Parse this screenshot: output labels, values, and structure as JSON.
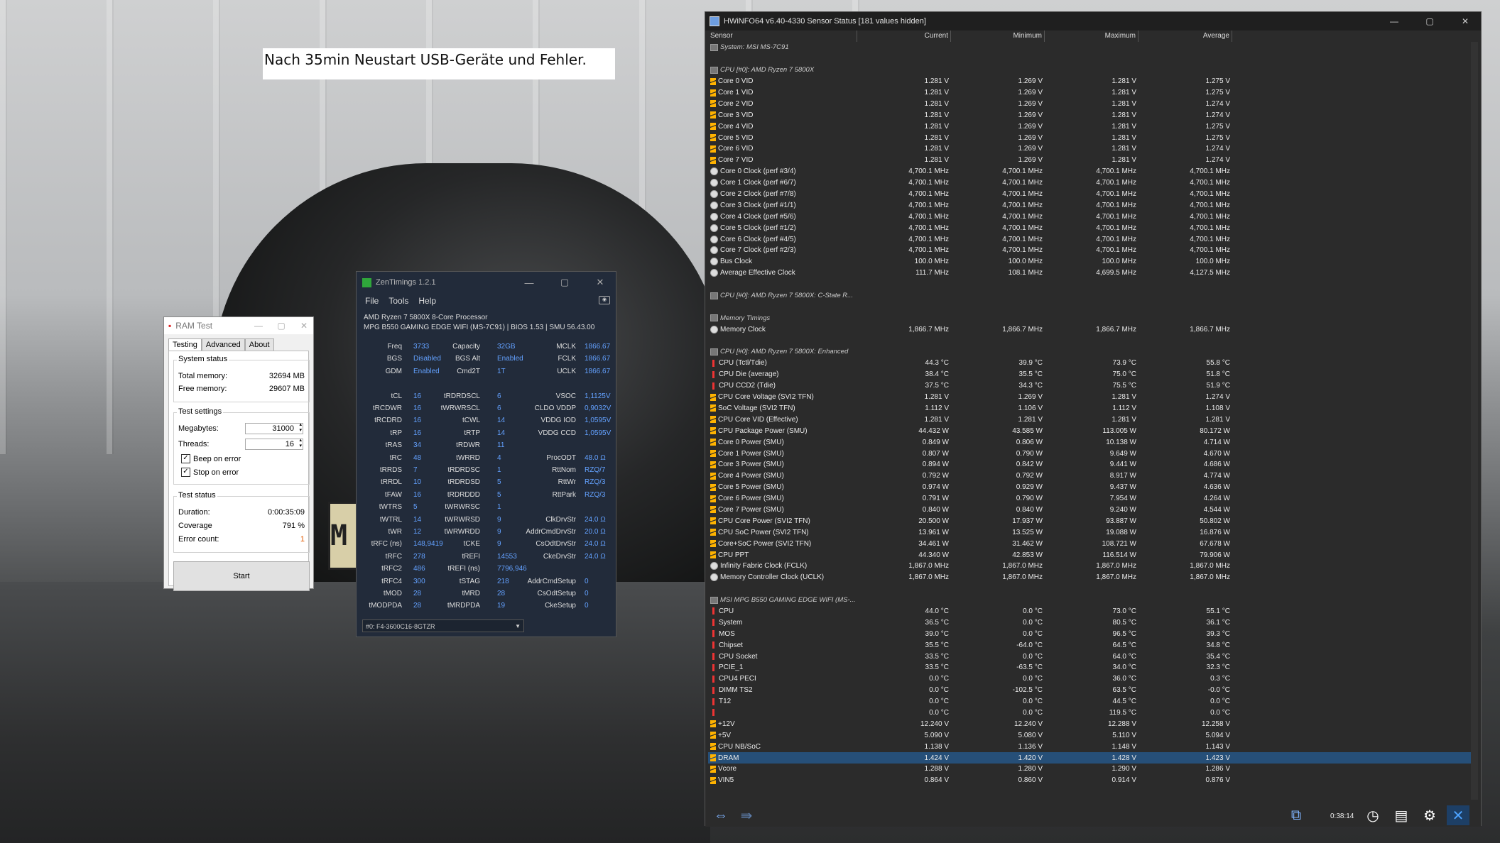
{
  "note": {
    "text": "Nach 35min Neustart USB-Geräte und Fehler."
  },
  "background": {
    "plate_text": "M"
  },
  "ramtest": {
    "title": "RAM Test",
    "tabs": [
      "Testing",
      "Advanced",
      "About"
    ],
    "system_status": {
      "label": "System status",
      "total_label": "Total memory:",
      "total_value": "32694 MB",
      "free_label": "Free memory:",
      "free_value": "29607 MB"
    },
    "test_settings": {
      "label": "Test settings",
      "mb_label": "Megabytes:",
      "mb_value": "31000",
      "threads_label": "Threads:",
      "threads_value": "16",
      "beep_label": "Beep on error",
      "stop_label": "Stop on error"
    },
    "test_status": {
      "label": "Test status",
      "duration_label": "Duration:",
      "duration_value": "0:00:35:09",
      "coverage_label": "Coverage",
      "coverage_value": "791 %",
      "errors_label": "Error count:",
      "errors_value": "1"
    },
    "start_label": "Start"
  },
  "zen": {
    "title": "ZenTimings 1.2.1",
    "menu": [
      "File",
      "Tools",
      "Help"
    ],
    "cpu": "AMD Ryzen 7 5800X 8-Core Processor",
    "board": "MPG B550 GAMING EDGE WIFI (MS-7C91) | BIOS 1.53 | SMU 56.43.00",
    "col1": [
      [
        "Freq",
        "3733"
      ],
      [
        "BGS",
        "Disabled"
      ],
      [
        "GDM",
        "Enabled"
      ],
      [
        "",
        ""
      ],
      [
        "tCL",
        "16"
      ],
      [
        "tRCDWR",
        "16"
      ],
      [
        "tRCDRD",
        "16"
      ],
      [
        "tRP",
        "16"
      ],
      [
        "tRAS",
        "34"
      ],
      [
        "tRC",
        "48"
      ],
      [
        "tRRDS",
        "7"
      ],
      [
        "tRRDL",
        "10"
      ],
      [
        "tFAW",
        "16"
      ],
      [
        "tWTRS",
        "5"
      ],
      [
        "tWTRL",
        "14"
      ],
      [
        "tWR",
        "12"
      ],
      [
        "tRFC (ns)",
        "148,9419"
      ],
      [
        "tRFC",
        "278"
      ],
      [
        "tRFC2",
        "486"
      ],
      [
        "tRFC4",
        "300"
      ],
      [
        "tMOD",
        "28"
      ],
      [
        "tMODPDA",
        "28"
      ]
    ],
    "col2": [
      [
        "Capacity",
        "32GB"
      ],
      [
        "BGS Alt",
        "Enabled"
      ],
      [
        "Cmd2T",
        "1T"
      ],
      [
        "",
        ""
      ],
      [
        "tRDRDSCL",
        "6"
      ],
      [
        "tWRWRSCL",
        "6"
      ],
      [
        "tCWL",
        "14"
      ],
      [
        "tRTP",
        "14"
      ],
      [
        "tRDWR",
        "11"
      ],
      [
        "tWRRD",
        "4"
      ],
      [
        "tRDRDSC",
        "1"
      ],
      [
        "tRDRDSD",
        "5"
      ],
      [
        "tRDRDDD",
        "5"
      ],
      [
        "tWRWRSC",
        "1"
      ],
      [
        "tWRWRSD",
        "9"
      ],
      [
        "tWRWRDD",
        "9"
      ],
      [
        "tCKE",
        "9"
      ],
      [
        "tREFI",
        "14553"
      ],
      [
        "tREFI (ns)",
        "7796,946"
      ],
      [
        "tSTAG",
        "218"
      ],
      [
        "tMRD",
        "28"
      ],
      [
        "tMRDPDA",
        "19"
      ]
    ],
    "col3": [
      [
        "MCLK",
        "1866.67"
      ],
      [
        "FCLK",
        "1866.67"
      ],
      [
        "UCLK",
        "1866.67"
      ],
      [
        "",
        ""
      ],
      [
        "VSOC",
        "1,1125V"
      ],
      [
        "CLDO VDDP",
        "0,9032V"
      ],
      [
        "VDDG IOD",
        "1,0595V"
      ],
      [
        "VDDG CCD",
        "1,0595V"
      ],
      [
        "",
        ""
      ],
      [
        "ProcODT",
        "48.0 Ω"
      ],
      [
        "RttNom",
        "RZQ/7"
      ],
      [
        "RttWr",
        "RZQ/3"
      ],
      [
        "RttPark",
        "RZQ/3"
      ],
      [
        "",
        ""
      ],
      [
        "ClkDrvStr",
        "24.0 Ω"
      ],
      [
        "AddrCmdDrvStr",
        "20.0 Ω"
      ],
      [
        "CsOdtDrvStr",
        "24.0 Ω"
      ],
      [
        "CkeDrvStr",
        "24.0 Ω"
      ],
      [
        "",
        ""
      ],
      [
        "AddrCmdSetup",
        "0"
      ],
      [
        "CsOdtSetup",
        "0"
      ],
      [
        "CkeSetup",
        "0"
      ]
    ],
    "dimm_select": "#0: F4-3600C16-8GTZR"
  },
  "hw": {
    "title": "HWiNFO64 v6.40-4330 Sensor Status [181 values hidden]",
    "headers": [
      "Sensor",
      "Current",
      "Minimum",
      "Maximum",
      "Average"
    ],
    "timer": "0:38:14",
    "rows": [
      {
        "t": "section",
        "name": "System: MSI MS-7C91"
      },
      {
        "t": "blank"
      },
      {
        "t": "section",
        "name": "CPU [#0]: AMD Ryzen 7 5800X"
      },
      {
        "t": "volt",
        "name": "Core 0 VID",
        "v": [
          "1.281 V",
          "1.269 V",
          "1.281 V",
          "1.275 V"
        ]
      },
      {
        "t": "volt",
        "name": "Core 1 VID",
        "v": [
          "1.281 V",
          "1.269 V",
          "1.281 V",
          "1.275 V"
        ]
      },
      {
        "t": "volt",
        "name": "Core 2 VID",
        "v": [
          "1.281 V",
          "1.269 V",
          "1.281 V",
          "1.274 V"
        ]
      },
      {
        "t": "volt",
        "name": "Core 3 VID",
        "v": [
          "1.281 V",
          "1.269 V",
          "1.281 V",
          "1.274 V"
        ]
      },
      {
        "t": "volt",
        "name": "Core 4 VID",
        "v": [
          "1.281 V",
          "1.269 V",
          "1.281 V",
          "1.275 V"
        ]
      },
      {
        "t": "volt",
        "name": "Core 5 VID",
        "v": [
          "1.281 V",
          "1.269 V",
          "1.281 V",
          "1.275 V"
        ]
      },
      {
        "t": "volt",
        "name": "Core 6 VID",
        "v": [
          "1.281 V",
          "1.269 V",
          "1.281 V",
          "1.274 V"
        ]
      },
      {
        "t": "volt",
        "name": "Core 7 VID",
        "v": [
          "1.281 V",
          "1.269 V",
          "1.281 V",
          "1.274 V"
        ]
      },
      {
        "t": "clk",
        "name": "Core 0 Clock (perf #3/4)",
        "v": [
          "4,700.1 MHz",
          "4,700.1 MHz",
          "4,700.1 MHz",
          "4,700.1 MHz"
        ]
      },
      {
        "t": "clk",
        "name": "Core 1 Clock (perf #6/7)",
        "v": [
          "4,700.1 MHz",
          "4,700.1 MHz",
          "4,700.1 MHz",
          "4,700.1 MHz"
        ]
      },
      {
        "t": "clk",
        "name": "Core 2 Clock (perf #7/8)",
        "v": [
          "4,700.1 MHz",
          "4,700.1 MHz",
          "4,700.1 MHz",
          "4,700.1 MHz"
        ]
      },
      {
        "t": "clk",
        "name": "Core 3 Clock (perf #1/1)",
        "v": [
          "4,700.1 MHz",
          "4,700.1 MHz",
          "4,700.1 MHz",
          "4,700.1 MHz"
        ]
      },
      {
        "t": "clk",
        "name": "Core 4 Clock (perf #5/6)",
        "v": [
          "4,700.1 MHz",
          "4,700.1 MHz",
          "4,700.1 MHz",
          "4,700.1 MHz"
        ]
      },
      {
        "t": "clk",
        "name": "Core 5 Clock (perf #1/2)",
        "v": [
          "4,700.1 MHz",
          "4,700.1 MHz",
          "4,700.1 MHz",
          "4,700.1 MHz"
        ]
      },
      {
        "t": "clk",
        "name": "Core 6 Clock (perf #4/5)",
        "v": [
          "4,700.1 MHz",
          "4,700.1 MHz",
          "4,700.1 MHz",
          "4,700.1 MHz"
        ]
      },
      {
        "t": "clk",
        "name": "Core 7 Clock (perf #2/3)",
        "v": [
          "4,700.1 MHz",
          "4,700.1 MHz",
          "4,700.1 MHz",
          "4,700.1 MHz"
        ]
      },
      {
        "t": "clk",
        "name": "Bus Clock",
        "v": [
          "100.0 MHz",
          "100.0 MHz",
          "100.0 MHz",
          "100.0 MHz"
        ]
      },
      {
        "t": "clk",
        "name": "Average Effective Clock",
        "v": [
          "111.7 MHz",
          "108.1 MHz",
          "4,699.5 MHz",
          "4,127.5 MHz"
        ]
      },
      {
        "t": "blank"
      },
      {
        "t": "section",
        "name": "CPU [#0]: AMD Ryzen 7 5800X: C-State R..."
      },
      {
        "t": "blank"
      },
      {
        "t": "section",
        "name": "Memory Timings"
      },
      {
        "t": "clk",
        "name": "Memory Clock",
        "v": [
          "1,866.7 MHz",
          "1,866.7 MHz",
          "1,866.7 MHz",
          "1,866.7 MHz"
        ]
      },
      {
        "t": "blank"
      },
      {
        "t": "section",
        "name": "CPU [#0]: AMD Ryzen 7 5800X: Enhanced"
      },
      {
        "t": "temp",
        "name": "CPU (Tctl/Tdie)",
        "v": [
          "44.3 °C",
          "39.9 °C",
          "73.9 °C",
          "55.8 °C"
        ]
      },
      {
        "t": "temp",
        "name": "CPU Die (average)",
        "v": [
          "38.4 °C",
          "35.5 °C",
          "75.0 °C",
          "51.8 °C"
        ]
      },
      {
        "t": "temp",
        "name": "CPU CCD2 (Tdie)",
        "v": [
          "37.5 °C",
          "34.3 °C",
          "75.5 °C",
          "51.9 °C"
        ]
      },
      {
        "t": "volt",
        "name": "CPU Core Voltage (SVI2 TFN)",
        "v": [
          "1.281 V",
          "1.269 V",
          "1.281 V",
          "1.274 V"
        ]
      },
      {
        "t": "volt",
        "name": "SoC Voltage (SVI2 TFN)",
        "v": [
          "1.112 V",
          "1.106 V",
          "1.112 V",
          "1.108 V"
        ]
      },
      {
        "t": "volt",
        "name": "CPU Core VID (Effective)",
        "v": [
          "1.281 V",
          "1.281 V",
          "1.281 V",
          "1.281 V"
        ]
      },
      {
        "t": "pwr",
        "name": "CPU Package Power (SMU)",
        "v": [
          "44.432 W",
          "43.585 W",
          "113.005 W",
          "80.172 W"
        ]
      },
      {
        "t": "pwr",
        "name": "Core 0 Power (SMU)",
        "v": [
          "0.849 W",
          "0.806 W",
          "10.138 W",
          "4.714 W"
        ]
      },
      {
        "t": "pwr",
        "name": "Core 1 Power (SMU)",
        "v": [
          "0.807 W",
          "0.790 W",
          "9.649 W",
          "4.670 W"
        ]
      },
      {
        "t": "pwr",
        "name": "Core 3 Power (SMU)",
        "v": [
          "0.894 W",
          "0.842 W",
          "9.441 W",
          "4.686 W"
        ]
      },
      {
        "t": "pwr",
        "name": "Core 4 Power (SMU)",
        "v": [
          "0.792 W",
          "0.792 W",
          "8.917 W",
          "4.774 W"
        ]
      },
      {
        "t": "pwr",
        "name": "Core 5 Power (SMU)",
        "v": [
          "0.974 W",
          "0.929 W",
          "9.437 W",
          "4.636 W"
        ]
      },
      {
        "t": "pwr",
        "name": "Core 6 Power (SMU)",
        "v": [
          "0.791 W",
          "0.790 W",
          "7.954 W",
          "4.264 W"
        ]
      },
      {
        "t": "pwr",
        "name": "Core 7 Power (SMU)",
        "v": [
          "0.840 W",
          "0.840 W",
          "9.240 W",
          "4.544 W"
        ]
      },
      {
        "t": "pwr",
        "name": "CPU Core Power (SVI2 TFN)",
        "v": [
          "20.500 W",
          "17.937 W",
          "93.887 W",
          "50.802 W"
        ]
      },
      {
        "t": "pwr",
        "name": "CPU SoC Power (SVI2 TFN)",
        "v": [
          "13.961 W",
          "13.525 W",
          "19.088 W",
          "16.876 W"
        ]
      },
      {
        "t": "pwr",
        "name": "Core+SoC Power (SVI2 TFN)",
        "v": [
          "34.461 W",
          "31.462 W",
          "108.721 W",
          "67.678 W"
        ]
      },
      {
        "t": "pwr",
        "name": "CPU PPT",
        "v": [
          "44.340 W",
          "42.853 W",
          "116.514 W",
          "79.906 W"
        ]
      },
      {
        "t": "clk",
        "name": "Infinity Fabric Clock (FCLK)",
        "v": [
          "1,867.0 MHz",
          "1,867.0 MHz",
          "1,867.0 MHz",
          "1,867.0 MHz"
        ]
      },
      {
        "t": "clk",
        "name": "Memory Controller Clock (UCLK)",
        "v": [
          "1,867.0 MHz",
          "1,867.0 MHz",
          "1,867.0 MHz",
          "1,867.0 MHz"
        ]
      },
      {
        "t": "blank"
      },
      {
        "t": "section",
        "name": "MSI MPG B550 GAMING EDGE WIFI (MS-..."
      },
      {
        "t": "temp",
        "name": "CPU",
        "v": [
          "44.0 °C",
          "0.0 °C",
          "73.0 °C",
          "55.1 °C"
        ]
      },
      {
        "t": "temp",
        "name": "System",
        "v": [
          "36.5 °C",
          "0.0 °C",
          "80.5 °C",
          "36.1 °C"
        ]
      },
      {
        "t": "temp",
        "name": "MOS",
        "v": [
          "39.0 °C",
          "0.0 °C",
          "96.5 °C",
          "39.3 °C"
        ]
      },
      {
        "t": "temp",
        "name": "Chipset",
        "v": [
          "35.5 °C",
          "-64.0 °C",
          "64.5 °C",
          "34.8 °C"
        ]
      },
      {
        "t": "temp",
        "name": "CPU Socket",
        "v": [
          "33.5 °C",
          "0.0 °C",
          "64.0 °C",
          "35.4 °C"
        ]
      },
      {
        "t": "temp",
        "name": "PCIE_1",
        "v": [
          "33.5 °C",
          "-63.5 °C",
          "34.0 °C",
          "32.3 °C"
        ]
      },
      {
        "t": "temp",
        "name": "CPU4 PECI",
        "v": [
          "0.0 °C",
          "0.0 °C",
          "36.0 °C",
          "0.3 °C"
        ]
      },
      {
        "t": "temp",
        "name": "DIMM TS2",
        "v": [
          "0.0 °C",
          "-102.5 °C",
          "63.5 °C",
          "-0.0 °C"
        ]
      },
      {
        "t": "temp",
        "name": "T12",
        "v": [
          "0.0 °C",
          "0.0 °C",
          "44.5 °C",
          "0.0 °C"
        ]
      },
      {
        "t": "temp",
        "name": "",
        "v": [
          "0.0 °C",
          "0.0 °C",
          "119.5 °C",
          "0.0 °C"
        ]
      },
      {
        "t": "volt",
        "name": "+12V",
        "v": [
          "12.240 V",
          "12.240 V",
          "12.288 V",
          "12.258 V"
        ]
      },
      {
        "t": "volt",
        "name": "+5V",
        "v": [
          "5.090 V",
          "5.080 V",
          "5.110 V",
          "5.094 V"
        ]
      },
      {
        "t": "volt",
        "name": "CPU NB/SoC",
        "v": [
          "1.138 V",
          "1.136 V",
          "1.148 V",
          "1.143 V"
        ]
      },
      {
        "t": "volt",
        "name": "DRAM",
        "v": [
          "1.424 V",
          "1.420 V",
          "1.428 V",
          "1.423 V"
        ],
        "sel": true
      },
      {
        "t": "volt",
        "name": "Vcore",
        "v": [
          "1.288 V",
          "1.280 V",
          "1.290 V",
          "1.286 V"
        ]
      },
      {
        "t": "volt",
        "name": "VIN5",
        "v": [
          "0.864 V",
          "0.860 V",
          "0.914 V",
          "0.876 V"
        ]
      }
    ]
  }
}
